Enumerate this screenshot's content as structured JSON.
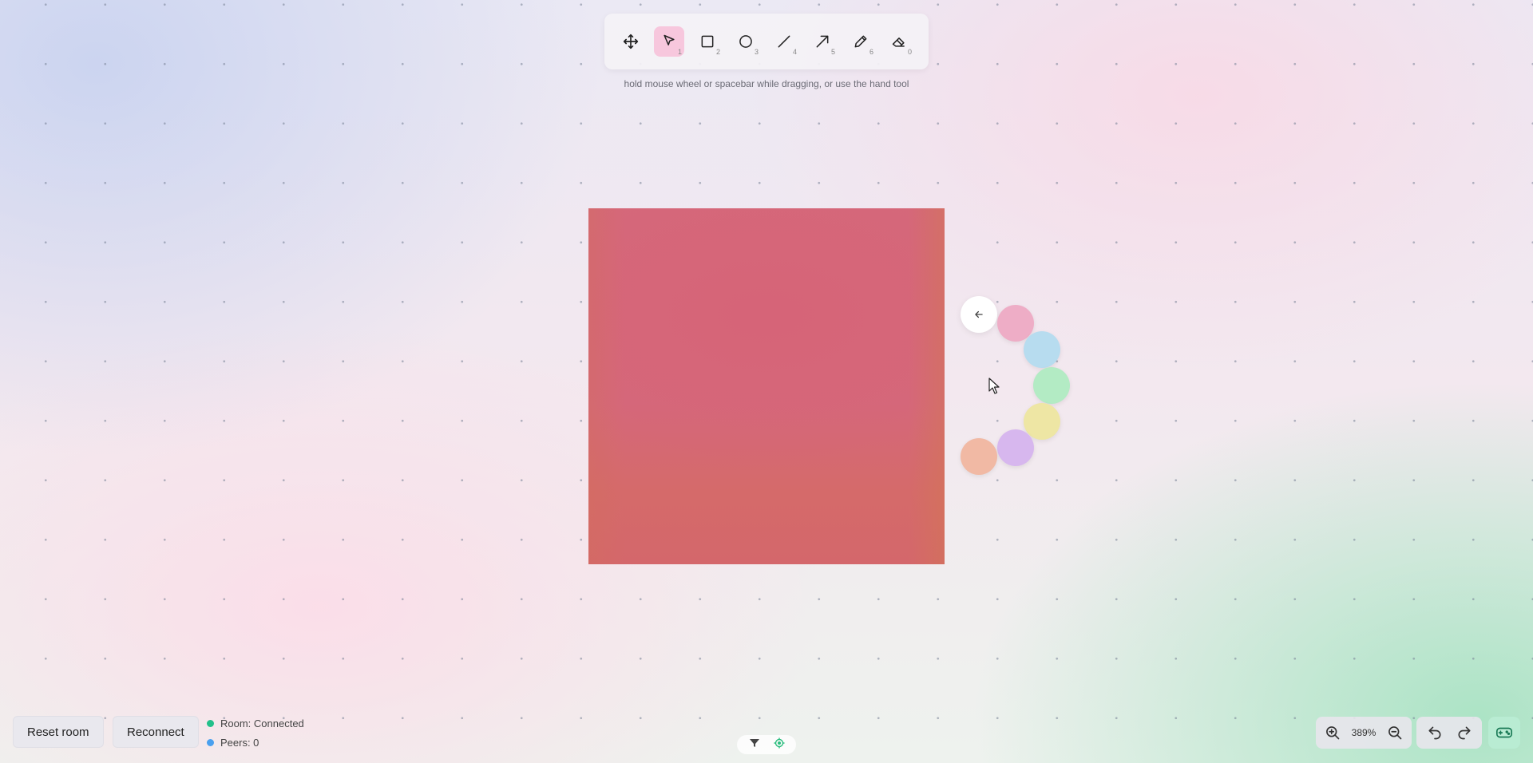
{
  "toolbar": {
    "tools": [
      {
        "name": "hand",
        "icon": "move-icon",
        "shortcut": ""
      },
      {
        "name": "select",
        "icon": "pointer-icon",
        "shortcut": "1",
        "active": true
      },
      {
        "name": "rectangle",
        "icon": "square-icon",
        "shortcut": "2"
      },
      {
        "name": "ellipse",
        "icon": "circle-icon",
        "shortcut": "3"
      },
      {
        "name": "line",
        "icon": "line-icon",
        "shortcut": "4"
      },
      {
        "name": "arrow",
        "icon": "arrow-icon",
        "shortcut": "5"
      },
      {
        "name": "pencil",
        "icon": "pencil-icon",
        "shortcut": "6"
      },
      {
        "name": "eraser",
        "icon": "eraser-icon",
        "shortcut": "0"
      }
    ],
    "hint": "hold mouse wheel or spacebar while dragging, or use the hand tool"
  },
  "canvas": {
    "shape_color": "#d5687a"
  },
  "color_picker": {
    "back_icon": "arrow-left-icon",
    "swatches": [
      "#eeadc6",
      "#b7dcef",
      "#b3ebc4",
      "#eee6a4",
      "#d7b7ee",
      "#f1b9a4"
    ]
  },
  "bottom_left": {
    "reset_label": "Reset room",
    "reconnect_label": "Reconnect",
    "room_status": "Room: Connected",
    "room_status_color": "#22c08a",
    "peers": "Peers: 0",
    "peers_color": "#4aa0ef"
  },
  "bottom_right": {
    "zoom": "389%"
  }
}
